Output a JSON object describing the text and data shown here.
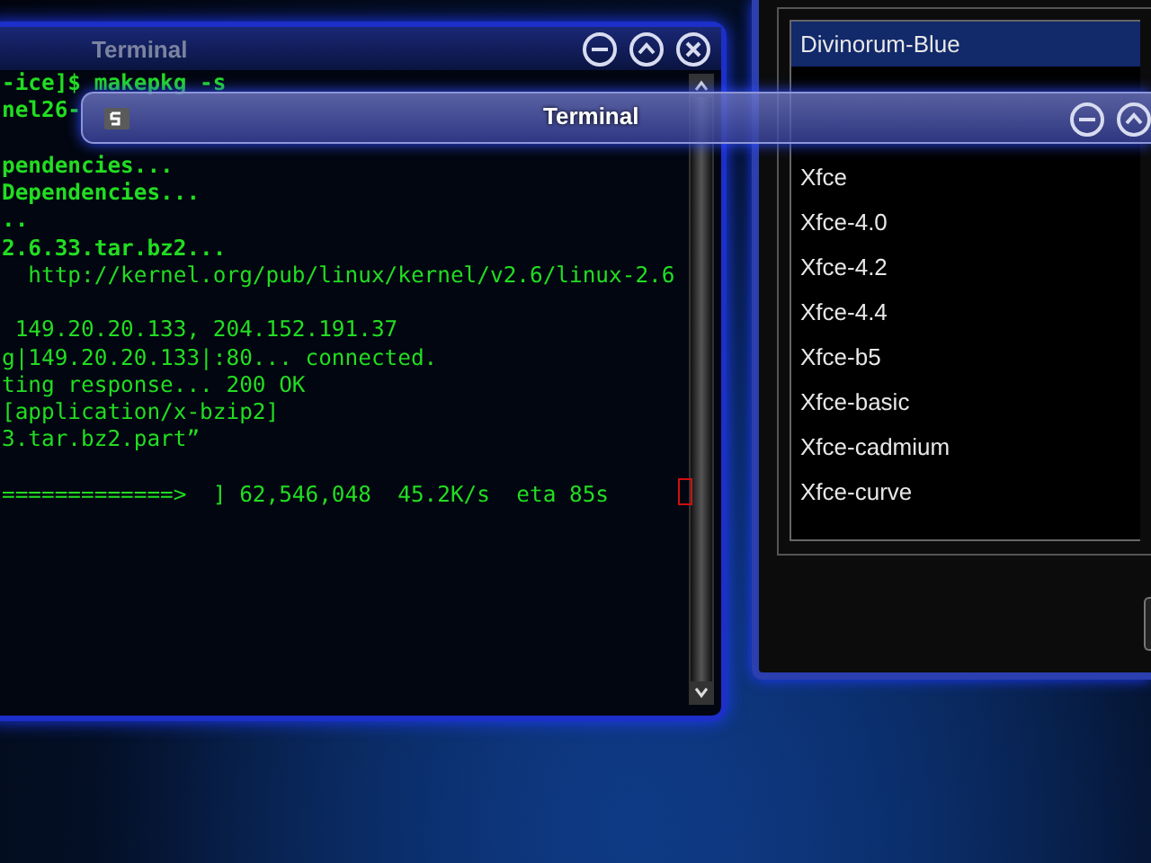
{
  "back_terminal": {
    "title": "Terminal",
    "lines": [
      {
        "kind": "bold",
        "text": "-ice]$ makepkg -s"
      },
      {
        "kind": "bold",
        "text": "nel26-"
      },
      {
        "kind": "blank"
      },
      {
        "kind": "bold",
        "text": "pendencies..."
      },
      {
        "kind": "bold",
        "text": "Dependencies..."
      },
      {
        "kind": "bold",
        "text": ".."
      },
      {
        "kind": "bold",
        "text": "2.6.33.tar.bz2..."
      },
      {
        "kind": "plain",
        "text": "  http://kernel.org/pub/linux/kernel/v2.6/linux-2.6"
      },
      {
        "kind": "blank"
      },
      {
        "kind": "plain",
        "text": " 149.20.20.133, 204.152.191.37"
      },
      {
        "kind": "plain",
        "text": "g|149.20.20.133|:80... connected."
      },
      {
        "kind": "plain",
        "text": "ting response... 200 OK"
      },
      {
        "kind": "plain",
        "text": "[application/x-bzip2]"
      },
      {
        "kind": "plain",
        "text": "3.tar.bz2.part”"
      },
      {
        "kind": "blank"
      },
      {
        "kind": "plain",
        "text": "=============>  ] 62,546,048  45.2K/s  eta 85s"
      }
    ]
  },
  "front_terminal": {
    "title": "Terminal"
  },
  "theme_list": {
    "items": [
      {
        "label": "Divinorum-Blue",
        "selected": true
      },
      {
        "label": "Xfce",
        "selected": false
      },
      {
        "label": "Xfce-4.0",
        "selected": false
      },
      {
        "label": "Xfce-4.2",
        "selected": false
      },
      {
        "label": "Xfce-4.4",
        "selected": false
      },
      {
        "label": "Xfce-b5",
        "selected": false
      },
      {
        "label": "Xfce-basic",
        "selected": false
      },
      {
        "label": "Xfce-cadmium",
        "selected": false
      },
      {
        "label": "Xfce-curve",
        "selected": false
      }
    ]
  }
}
